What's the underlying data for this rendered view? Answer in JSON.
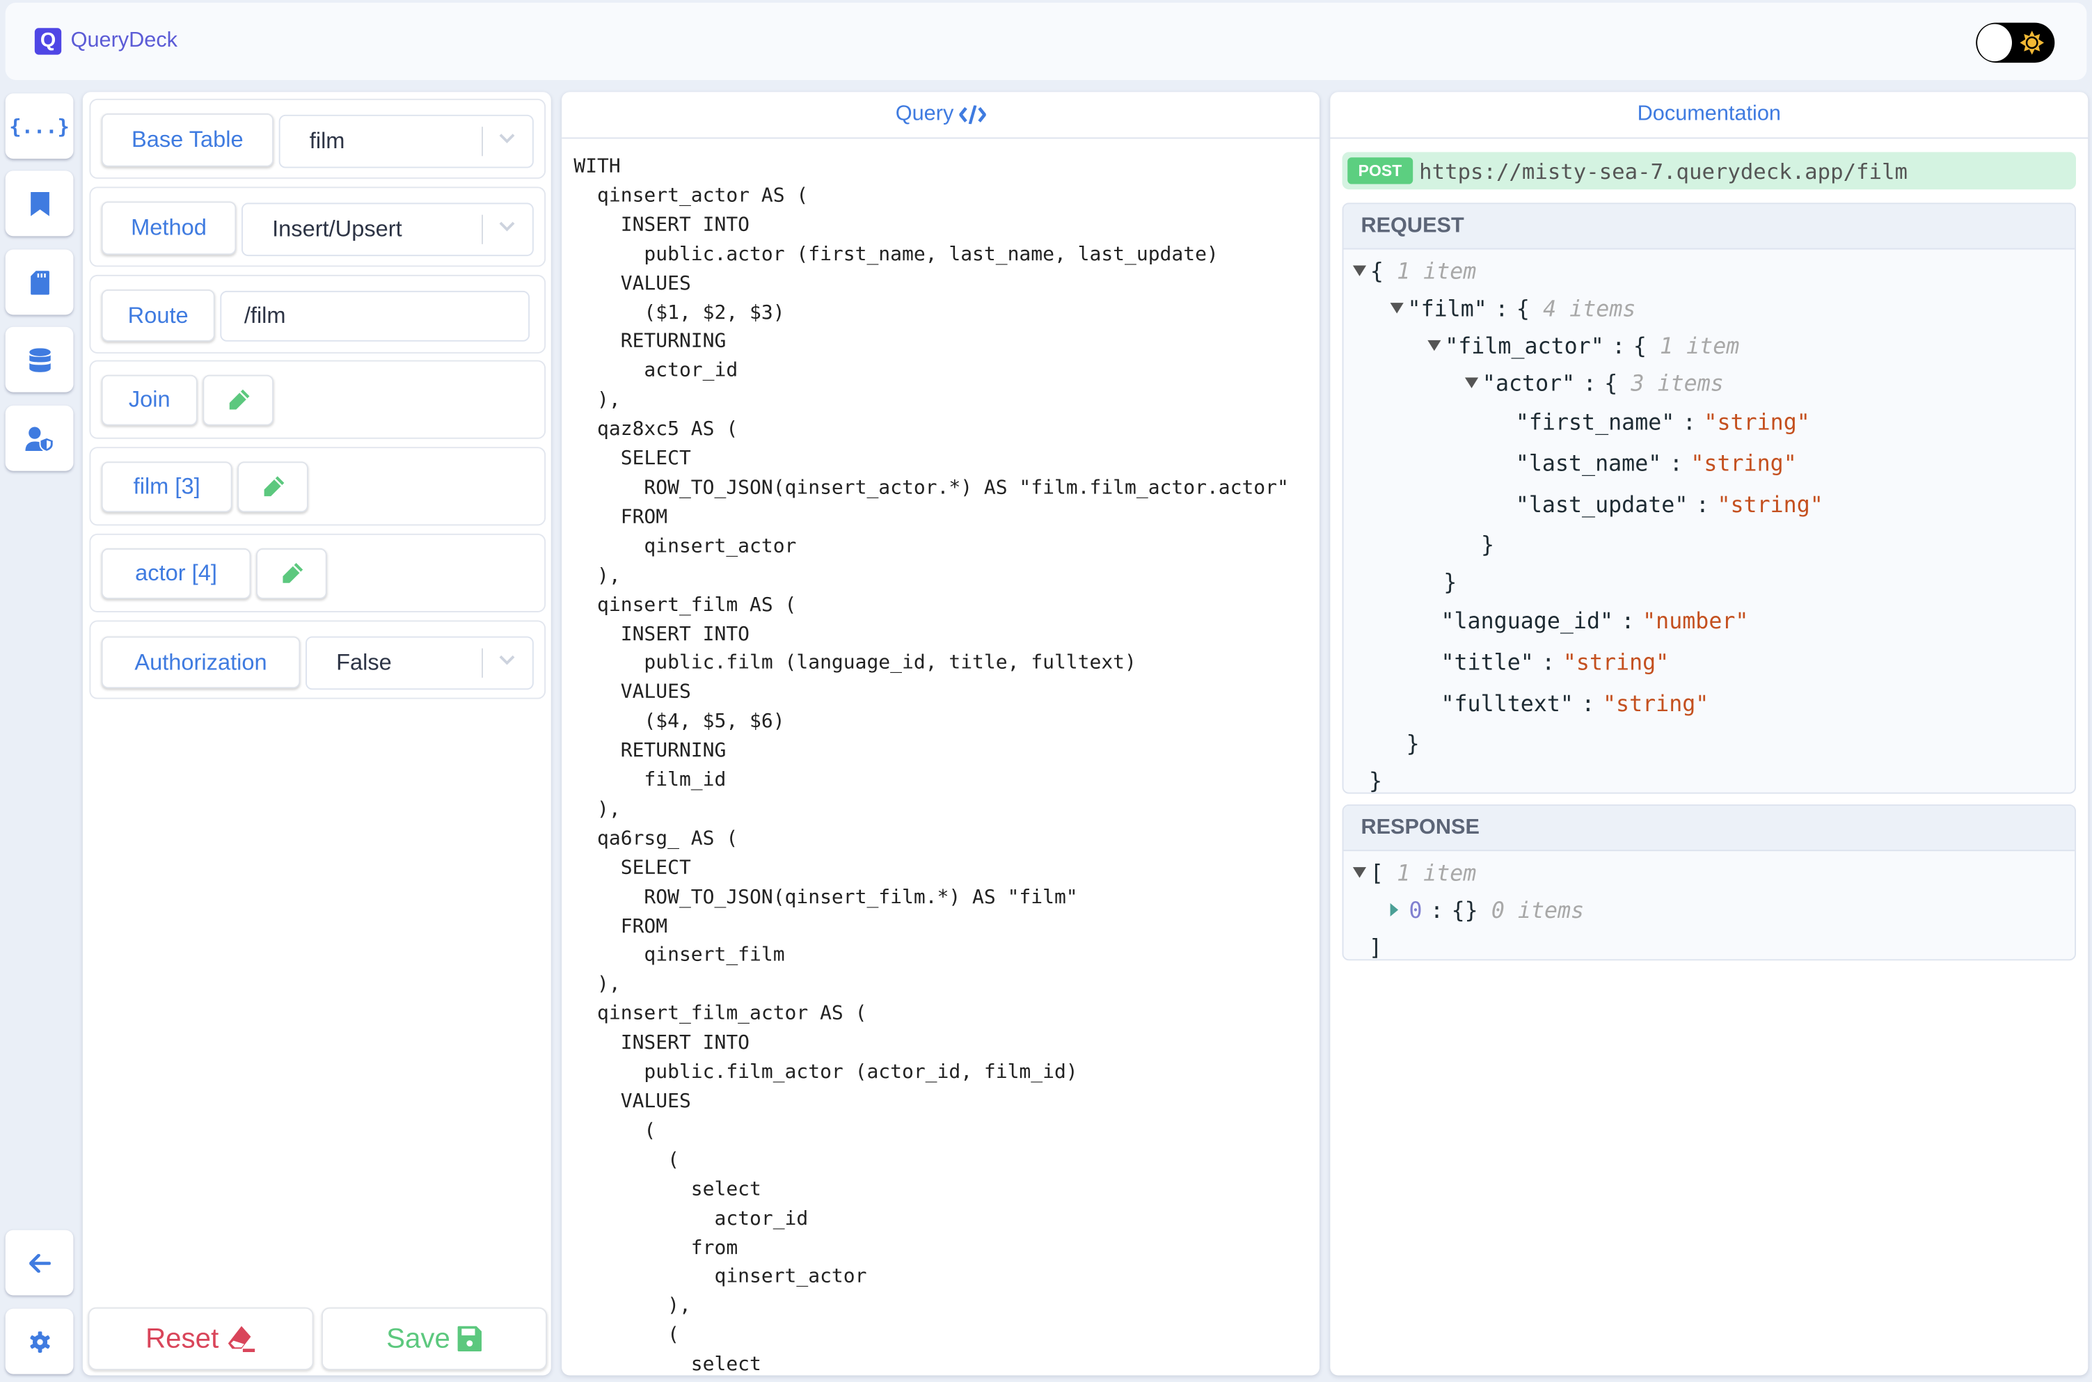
{
  "app": {
    "name": "QueryDeck",
    "logo_letter": "Q",
    "brand_color": "#4f46e5",
    "accent_color": "#3f7be0"
  },
  "theme_toggle": {
    "icon": "sun-icon",
    "state": "light"
  },
  "rail": {
    "items": [
      {
        "icon": "curly-braces-icon",
        "label": "{...}"
      },
      {
        "icon": "bookmark-icon"
      },
      {
        "icon": "sd-card-icon"
      },
      {
        "icon": "database-icon"
      },
      {
        "icon": "user-shield-icon"
      }
    ],
    "bottom": [
      {
        "icon": "arrow-left-icon"
      },
      {
        "icon": "gear-icon"
      }
    ]
  },
  "builder": {
    "base_table": {
      "label": "Base Table",
      "value": "film"
    },
    "method": {
      "label": "Method",
      "value": "Insert/Upsert"
    },
    "route": {
      "label": "Route",
      "value": "/film"
    },
    "join": {
      "label": "Join"
    },
    "film": {
      "label": "film [3]"
    },
    "actor": {
      "label": "actor [4]"
    },
    "authorization": {
      "label": "Authorization",
      "value": "False"
    },
    "reset_label": "Reset",
    "save_label": "Save"
  },
  "query": {
    "title": "Query",
    "lines": [
      "WITH",
      "  qinsert_actor AS (",
      "    INSERT INTO",
      "      public.actor (first_name, last_name, last_update)",
      "    VALUES",
      "      ($1, $2, $3)",
      "    RETURNING",
      "      actor_id",
      "  ),",
      "  qaz8xc5 AS (",
      "    SELECT",
      "      ROW_TO_JSON(qinsert_actor.*) AS \"film.film_actor.actor\"",
      "    FROM",
      "      qinsert_actor",
      "  ),",
      "  qinsert_film AS (",
      "    INSERT INTO",
      "      public.film (language_id, title, fulltext)",
      "    VALUES",
      "      ($4, $5, $6)",
      "    RETURNING",
      "      film_id",
      "  ),",
      "  qa6rsg_ AS (",
      "    SELECT",
      "      ROW_TO_JSON(qinsert_film.*) AS \"film\"",
      "    FROM",
      "      qinsert_film",
      "  ),",
      "  qinsert_film_actor AS (",
      "    INSERT INTO",
      "      public.film_actor (actor_id, film_id)",
      "    VALUES",
      "      (",
      "        (",
      "          select",
      "            actor_id",
      "          from",
      "            qinsert_actor",
      "        ),",
      "        (",
      "          select"
    ]
  },
  "docs": {
    "title": "Documentation",
    "method": "POST",
    "url": "https://misty-sea-7.querydeck.app/film",
    "request": {
      "title": "REQUEST",
      "rows": [
        {
          "d": 0,
          "tog": "open",
          "open": "{",
          "meta": "1 item"
        },
        {
          "d": 1,
          "tog": "open",
          "key": "\"film\"",
          "open": "{",
          "meta": "4 items"
        },
        {
          "d": 2,
          "tog": "open",
          "key": "\"film_actor\"",
          "open": "{",
          "meta": "1 item"
        },
        {
          "d": 3,
          "tog": "open",
          "key": "\"actor\"",
          "open": "{",
          "meta": "3 items"
        },
        {
          "d": 4,
          "key": "\"first_name\"",
          "val": "\"string\""
        },
        {
          "d": 4,
          "key": "\"last_name\"",
          "val": "\"string\""
        },
        {
          "d": 4,
          "key": "\"last_update\"",
          "val": "\"string\""
        },
        {
          "d": 3,
          "close": "}"
        },
        {
          "d": 2,
          "close": "}"
        },
        {
          "d": 2,
          "key": "\"language_id\"",
          "val": "\"number\""
        },
        {
          "d": 2,
          "key": "\"title\"",
          "val": "\"string\""
        },
        {
          "d": 2,
          "key": "\"fulltext\"",
          "val": "\"string\""
        },
        {
          "d": 1,
          "close": "}"
        },
        {
          "d": 0,
          "close": "}"
        }
      ]
    },
    "response": {
      "title": "RESPONSE",
      "rows": [
        {
          "d": 0,
          "tog": "open",
          "open": "[",
          "meta": "1 item"
        },
        {
          "d": 1,
          "tog": "closed",
          "idx": "0",
          "open": "{}",
          "meta": "0 items"
        },
        {
          "d": 0,
          "close": "]"
        }
      ]
    }
  }
}
